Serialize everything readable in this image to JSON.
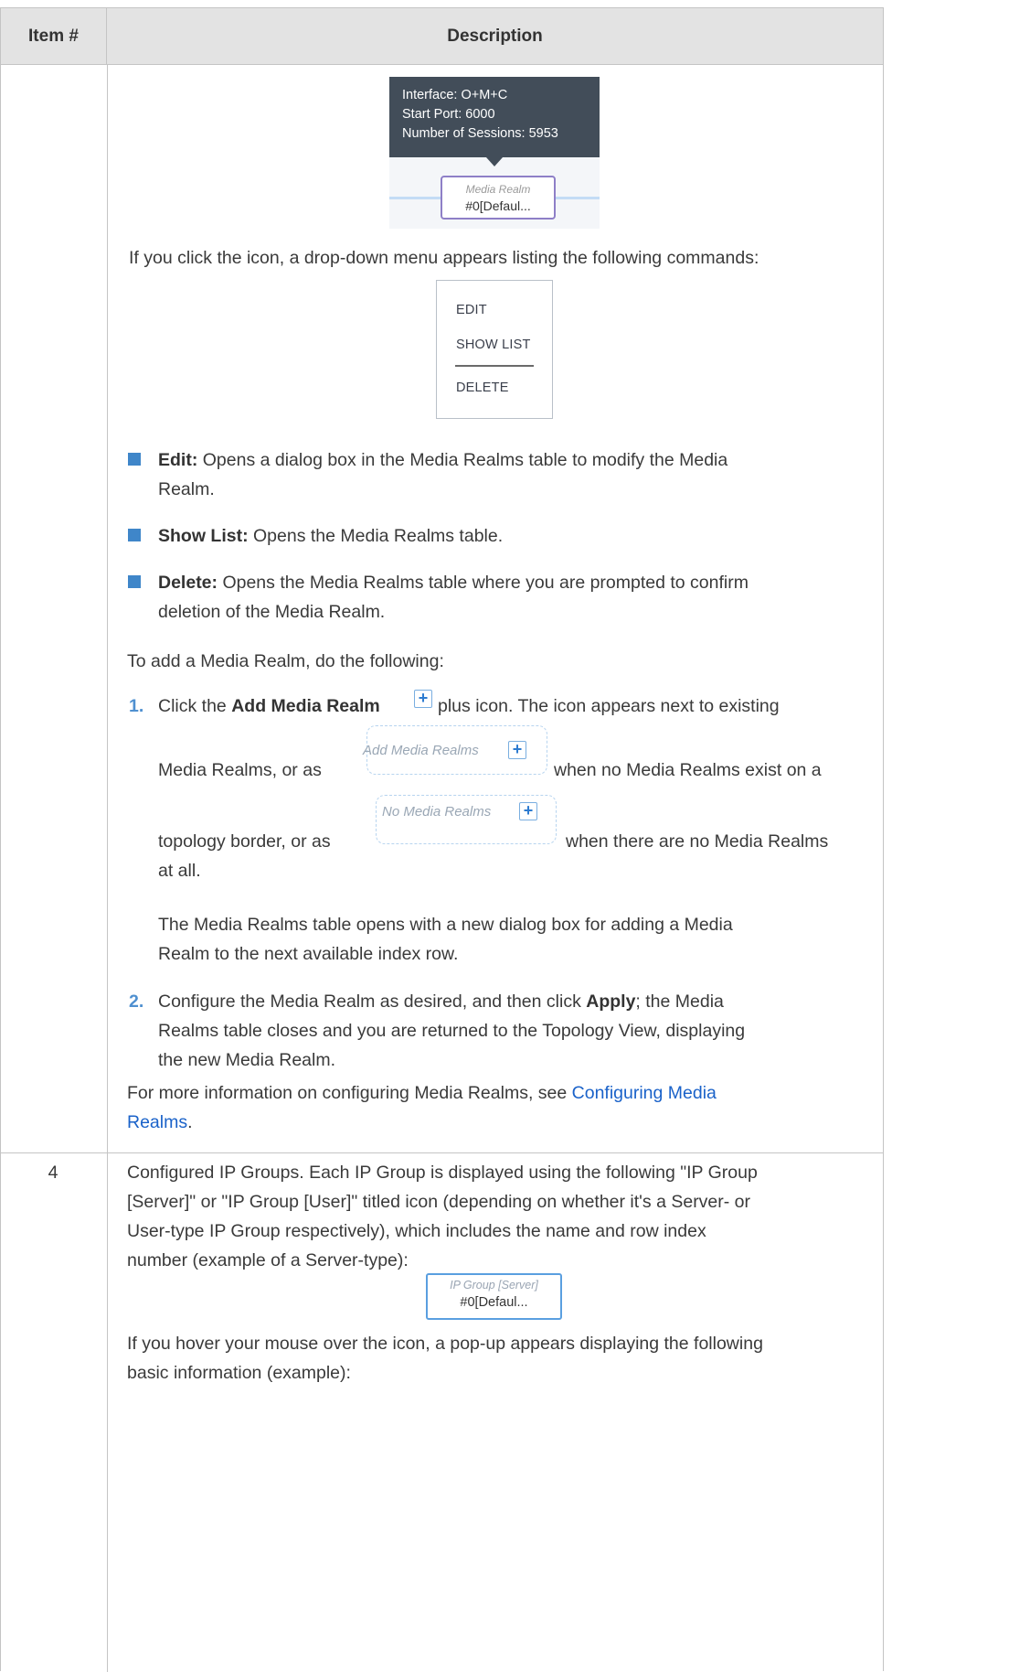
{
  "header": {
    "item_col": "Item #",
    "desc_col": "Description"
  },
  "tooltip": {
    "lines": [
      "Interface: O+M+C",
      "Start Port: 6000",
      "Number of Sessions: 5953"
    ],
    "realm_label": "Media Realm",
    "realm_value": "#0[Defaul..."
  },
  "intro_click": "If you click the icon, a drop-down menu appears listing the following commands:",
  "menu": {
    "items": [
      "EDIT",
      "SHOW LIST",
      "DELETE"
    ]
  },
  "bullets": [
    {
      "term": "Edit:",
      "text1": " Opens a dialog box in the Media Realms table to modify the Media",
      "text2": "Realm."
    },
    {
      "term": "Show List:",
      "text1": " Opens the Media Realms table.",
      "text2": ""
    },
    {
      "term": "Delete:",
      "text1": " Opens the Media Realms table where you are prompted to confirm",
      "text2": "deletion of the Media Realm."
    }
  ],
  "add_intro": "To add a Media Realm, do the following:",
  "steps": {
    "s1_num": "1.",
    "s1_a": "Click the ",
    "s1_b": "Add Media Realm",
    "s1_c": " plus icon. The icon appears next to existing",
    "s1_d": "Media Realms, or as",
    "s1_e": "when no Media Realms exist on a",
    "s1_f": "topology border, or as",
    "s1_g": "when there are no Media Realms",
    "s1_h": "at all.",
    "add_box_label": "Add Media Realms",
    "none_box_label": "No Media Realms",
    "s1_p2a": "The Media Realms table opens with a new dialog box for adding a Media",
    "s1_p2b": "Realm to the next available index row.",
    "s2_num": "2.",
    "s2_a": "Configure the Media Realm as desired, and then click ",
    "s2_b": "Apply",
    "s2_c": "; the Media",
    "s2_d": "Realms table closes and you are returned to the Topology View, displaying",
    "s2_e": "the new Media Realm."
  },
  "more_info": {
    "text": "For more information on configuring Media Realms, see ",
    "link1": "Configuring Media",
    "link2": "Realms",
    "end": "."
  },
  "row4": {
    "item": "4",
    "p1": "Configured IP Groups. Each IP Group is displayed using the following \"IP Group",
    "p2": "[Server]\" or \"IP Group [User]\" titled icon (depending on whether it's a Server- or",
    "p3": "User-type IP Group respectively), which includes the name and row index",
    "p4": "number (example of a Server-type):",
    "ipg_label": "IP Group [Server]",
    "ipg_value": "#0[Defaul...",
    "hover1": "If you hover your mouse over the icon, a pop-up appears displaying the following",
    "hover2": "basic information (example):"
  }
}
